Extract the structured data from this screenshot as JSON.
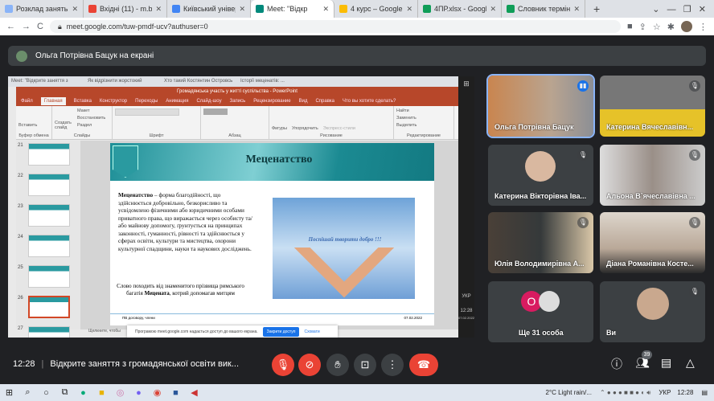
{
  "browser": {
    "tabs": [
      {
        "label": "Розклад занять",
        "color": "#8ab4f8"
      },
      {
        "label": "Вхідні (11) - m.ba",
        "color": "#ea4335"
      },
      {
        "label": "Київський універ",
        "color": "#4285f4"
      },
      {
        "label": "Meet: \"Відкр",
        "color": "#00897b",
        "active": true
      },
      {
        "label": "4 курс – Google",
        "color": "#fbbc04"
      },
      {
        "label": "4ПР.xlsx - Googl",
        "color": "#0f9d58"
      },
      {
        "label": "Словник термін",
        "color": "#0f9d58"
      }
    ],
    "url": "meet.google.com/tuw-pmdf-ucv?authuser=0"
  },
  "meet": {
    "presenter_banner": "Ольга Потрівна Бацук на екрані",
    "participants": [
      {
        "name": "Ольга Потрівна Бацук",
        "speaking": true
      },
      {
        "name": "Катерина Вячеславівн...",
        "muted": true
      },
      {
        "name": "Катерина Вікторівна Іва...",
        "muted": true
      },
      {
        "name": "Альона В`ячеславівна ...",
        "muted": true
      },
      {
        "name": "Юлія Володимирівна А...",
        "muted": true
      },
      {
        "name": "Діана Романівна Косте...",
        "muted": true
      },
      {
        "name": "Ще 31 особа",
        "avatar_letter": "О"
      },
      {
        "name": "Ви",
        "muted": true
      }
    ],
    "time": "12:28",
    "meeting_title": "Відкрите заняття з громадянської освіти вик...",
    "participants_count": "39"
  },
  "shared": {
    "inner_tabs": [
      "Meet: \"Відкрите заняття з",
      "Як відрізнити жорстокий",
      "Хто такий Костянтин Островсь",
      "Історії меценатів: ..."
    ],
    "window_title": "Громадянська участь у житті суспільства - PowerPoint",
    "ribbon_tabs": [
      "Файл",
      "Главная",
      "Вставка",
      "Конструктор",
      "Переходы",
      "Анимация",
      "Слайд-шоу",
      "Запись",
      "Рецензирование",
      "Вид",
      "Справка",
      "Что вы хотите сделать?"
    ],
    "ribbon_groups": [
      "Буфер обмена",
      "Слайды",
      "Шрифт",
      "Абзац",
      "Рисование",
      "Редактирование"
    ],
    "ribbon_buttons": [
      "Вставить",
      "Создать слайд",
      "Макет",
      "Восстановить",
      "Раздел",
      "Фигуры",
      "Упорядочить",
      "Экспресс-стили",
      "Найти",
      "Заменить",
      "Выделить"
    ],
    "slide_numbers": [
      "21",
      "22",
      "23",
      "24",
      "25",
      "26",
      "27"
    ],
    "slide": {
      "title": "Меценатство",
      "term": "Меценатство",
      "body": " – форма благодійності, що здійснюється добровільно, безкорисливо та усвідомлено фізичними або юридичними особами приватного права, що виражається через особисту та/або майнову допомогу, ґрунтується на принципах законності, гуманності, рівності та здійснюється у сферах освіти, культури та мистецтва, охорони культурної спадщини, науки та наукових досліджень.",
      "note_pre": "Слово походить від знаменитого прізвища римського багатія ",
      "note_bold": "Мецената",
      "note_post": ", котрий допомагав митцям",
      "image_text": "Поспішай творити добро !!!",
      "footer_left": "ПВ договору, члени",
      "footer_right": "07.02.2022"
    },
    "notes_hint": "Щелкните, чтобы",
    "notice": {
      "text": "Програмою meet.google.com надається доступ до вашого екрана.",
      "stop": "Закрити доступ",
      "hide": "Сховати"
    },
    "win_tray": {
      "lang": "УКР",
      "time": "12:28",
      "date": "07.02.2022"
    }
  },
  "taskbar": {
    "weather": "2°C  Light rain/...",
    "lang": "УКР",
    "time": "12:28"
  }
}
